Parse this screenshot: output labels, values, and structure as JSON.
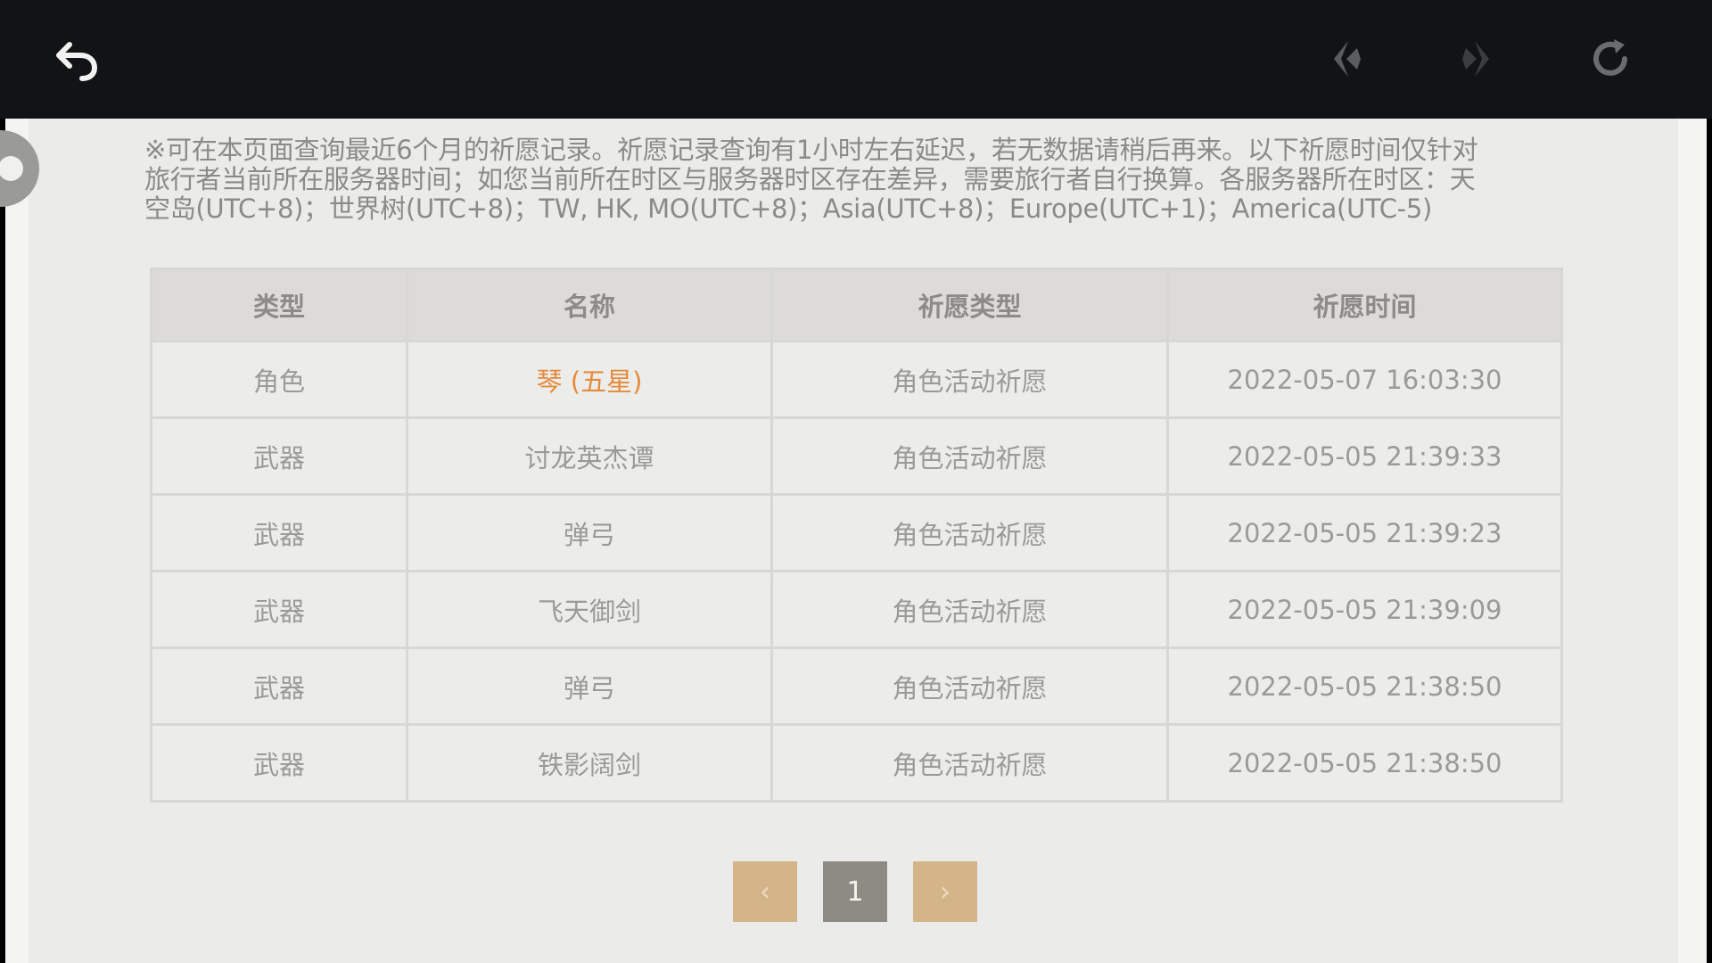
{
  "toolbar": {
    "back_icon": "undo-arrow-icon",
    "nav_back_icon": "diamond-back-icon",
    "nav_forward_icon": "diamond-forward-icon",
    "refresh_icon": "refresh-icon"
  },
  "notice": {
    "lines": [
      "※可在本页面查询最近6个月的祈愿记录。祈愿记录查询有1小时左右延迟，若无数据请稍后再来。以下祈愿时间仅针对",
      "旅行者当前所在服务器时间；如您当前所在时区与服务器时区存在差异，需要旅行者自行换算。各服务器所在时区：天",
      "空岛(UTC+8)；世界树(UTC+8)；TW, HK, MO(UTC+8)；Asia(UTC+8)；Europe(UTC+1)；America(UTC-5)"
    ]
  },
  "table": {
    "headers": [
      "类型",
      "名称",
      "祈愿类型",
      "祈愿时间"
    ],
    "rows": [
      [
        "角色",
        "琴 (五星)",
        "角色活动祈愿",
        "2022-05-07 16:03:30"
      ],
      [
        "武器",
        "讨龙英杰谭",
        "角色活动祈愿",
        "2022-05-05 21:39:33"
      ],
      [
        "武器",
        "弹弓",
        "角色活动祈愿",
        "2022-05-05 21:39:23"
      ],
      [
        "武器",
        "飞天御剑",
        "角色活动祈愿",
        "2022-05-05 21:39:09"
      ],
      [
        "武器",
        "弹弓",
        "角色活动祈愿",
        "2022-05-05 21:38:50"
      ],
      [
        "武器",
        "铁影阔剑",
        "角色活动祈愿",
        "2022-05-05 21:38:50"
      ]
    ]
  },
  "pagination": {
    "prev_label": "‹",
    "current_page": "1",
    "next_label": "›"
  },
  "colors": {
    "five_star": "#e48a3a",
    "header_bg": "#dcdbd8",
    "pager_accent": "#d4b58a"
  }
}
